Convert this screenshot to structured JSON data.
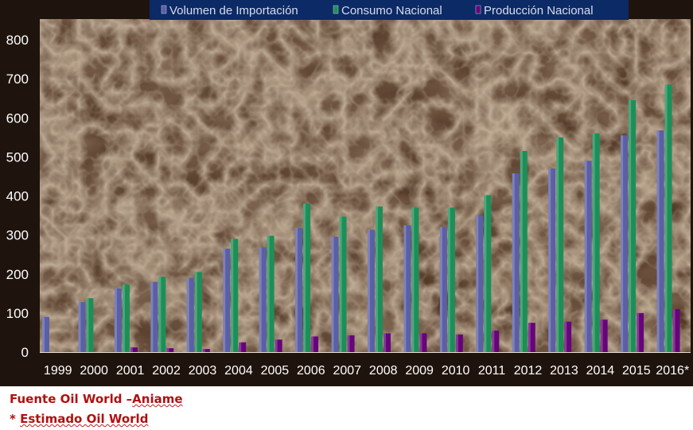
{
  "chart_data": {
    "type": "bar",
    "categories": [
      "1999",
      "2000",
      "2001",
      "2002",
      "2003",
      "2004",
      "2005",
      "2006",
      "2007",
      "2008",
      "2009",
      "2010",
      "2011",
      "2012",
      "2013",
      "2014",
      "2015",
      "2016*"
    ],
    "series": [
      {
        "name": "Volumen de Importación",
        "color": "#5a5fa6",
        "values": [
          90,
          128,
          163,
          180,
          190,
          265,
          268,
          318,
          295,
          313,
          325,
          320,
          350,
          458,
          470,
          490,
          555,
          568
        ]
      },
      {
        "name": "Consumo Nacional",
        "color": "#1c8f58",
        "values": [
          0,
          138,
          173,
          193,
          205,
          290,
          298,
          380,
          347,
          373,
          370,
          370,
          402,
          515,
          550,
          560,
          645,
          685
        ]
      },
      {
        "name": "Producción Nacional",
        "color": "#66047a",
        "values": [
          0,
          0,
          12,
          10,
          8,
          25,
          32,
          40,
          43,
          48,
          48,
          45,
          55,
          75,
          78,
          83,
          100,
          110
        ]
      }
    ],
    "ylim": [
      0,
      800
    ],
    "yticks": [
      0,
      100,
      200,
      300,
      400,
      500,
      600,
      700,
      800
    ],
    "legend_position": "top",
    "grid": false
  },
  "footnotes": {
    "source_prefix": "Fuente Oil World –",
    "source_org": "Aniame",
    "estimate_prefix": "* ",
    "estimate_text": "Estimado Oil World"
  },
  "colors": {
    "plot_bg": "#4d3322",
    "axis_text": "#ffffff",
    "legend_bg": "#0b2a66",
    "footnote": "#b01010"
  }
}
